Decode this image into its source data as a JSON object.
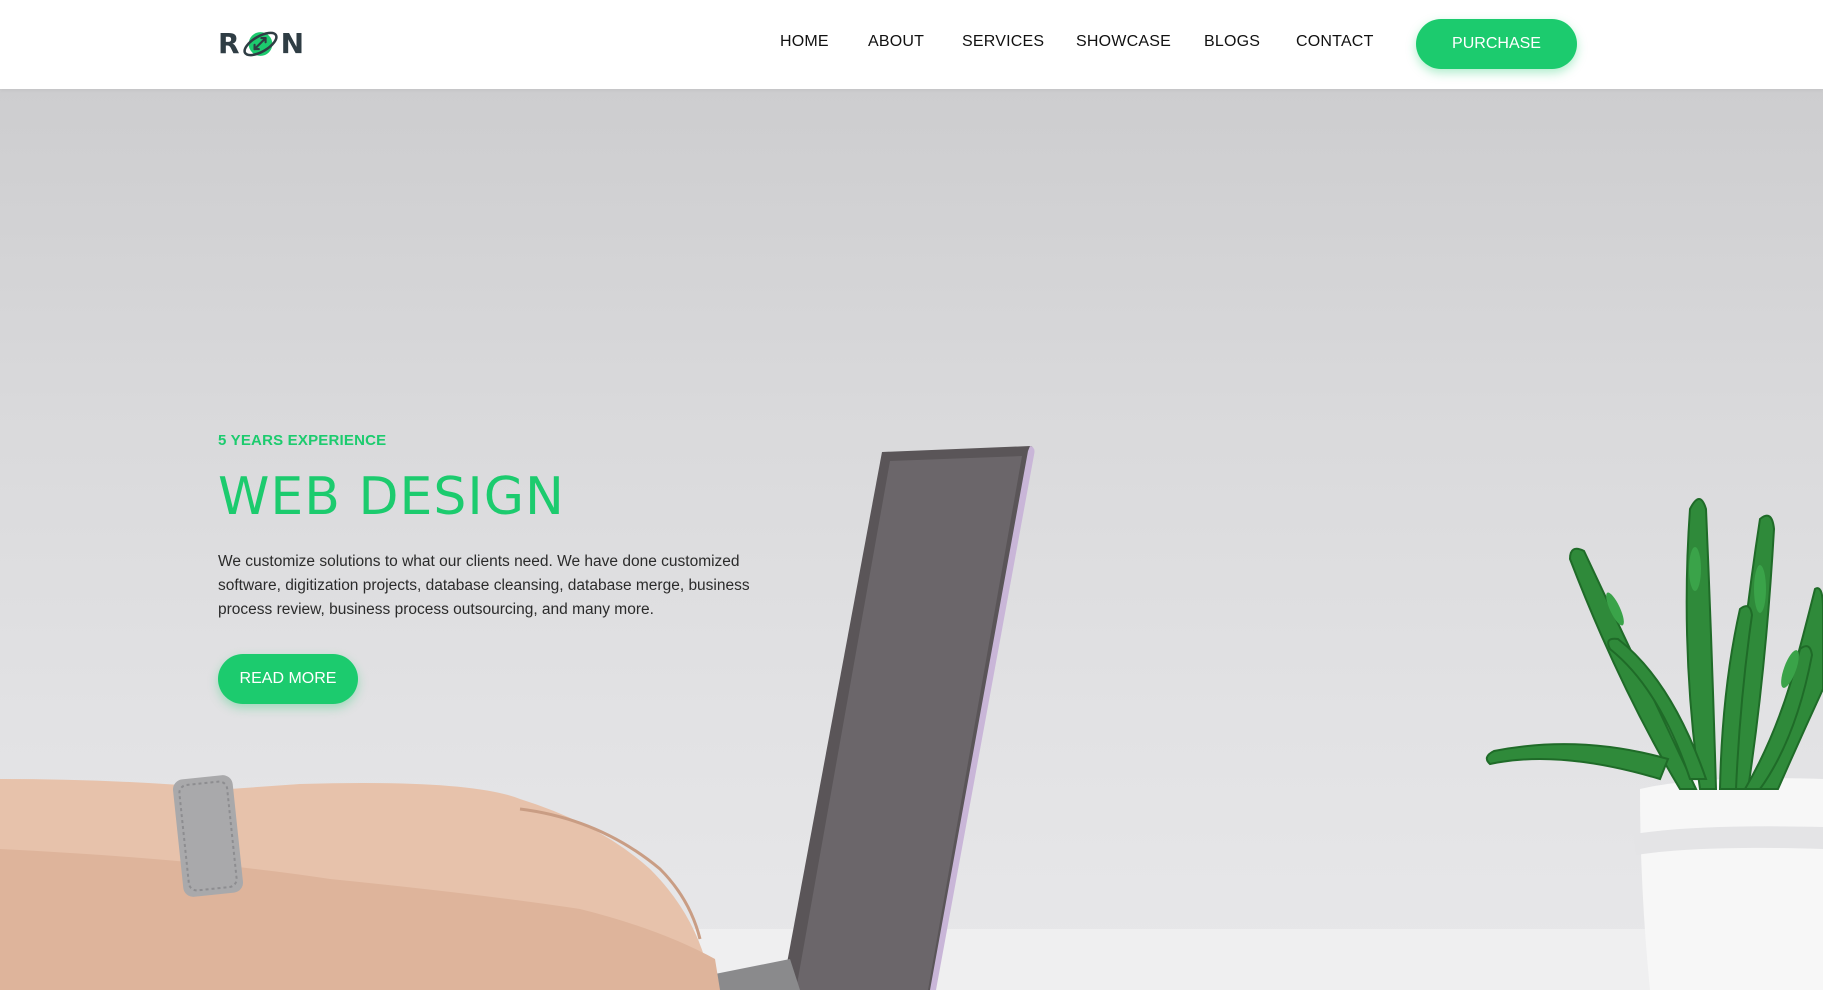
{
  "brand": {
    "logo_letter_left": "R",
    "logo_letter_right": "N",
    "logo_icon": "globe-arrows-icon",
    "accent_color": "#1ccb6e"
  },
  "nav": {
    "items": [
      {
        "label": "HOME"
      },
      {
        "label": "ABOUT"
      },
      {
        "label": "SERVICES"
      },
      {
        "label": "SHOWCASE"
      },
      {
        "label": "BLOGS"
      },
      {
        "label": "CONTACT"
      }
    ],
    "cta_label": "PURCHASE"
  },
  "hero": {
    "eyebrow": "5 YEARS EXPERIENCE",
    "title": "WEB DESIGN",
    "description": "We customize solutions to what our clients need. We have done customized software, digitization projects, database cleansing, database merge, business process review, business process outsourcing, and many more.",
    "button_label": "READ MORE",
    "background_image": "laptop-hands-plant-photo"
  }
}
